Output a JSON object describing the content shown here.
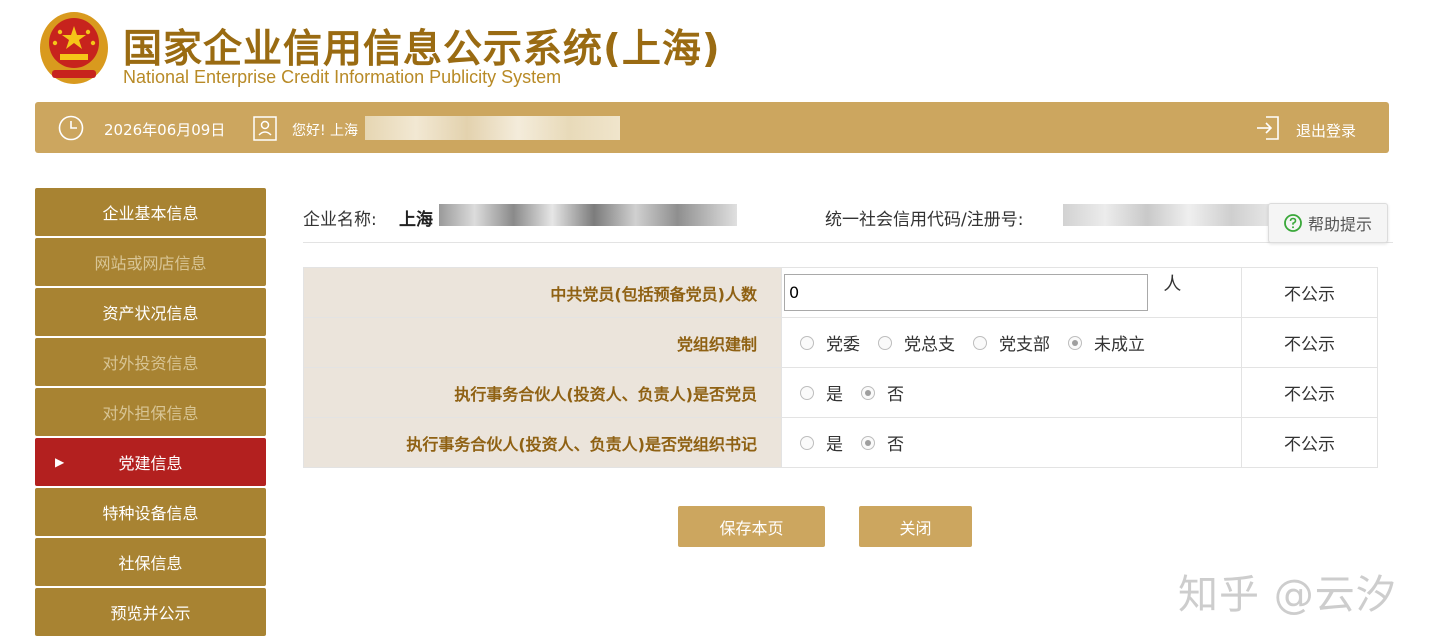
{
  "header": {
    "title_cn": "国家企业信用信息公示系统(上海)",
    "title_en": "National Enterprise Credit Information Publicity System",
    "emblem_icon": "national-emblem-icon"
  },
  "topbar": {
    "date": "2026年06月09日",
    "greeting": "您好! 上海",
    "logout": "退出登录"
  },
  "sidebar": {
    "items": [
      {
        "label": "企业基本信息",
        "state": "normal"
      },
      {
        "label": "网站或网店信息",
        "state": "disabled"
      },
      {
        "label": "资产状况信息",
        "state": "normal"
      },
      {
        "label": "对外投资信息",
        "state": "disabled"
      },
      {
        "label": "对外担保信息",
        "state": "disabled"
      },
      {
        "label": "党建信息",
        "state": "active"
      },
      {
        "label": "特种设备信息",
        "state": "normal"
      },
      {
        "label": "社保信息",
        "state": "normal"
      },
      {
        "label": "预览并公示",
        "state": "normal"
      }
    ]
  },
  "company": {
    "name_label": "企业名称:",
    "name_value": "上海",
    "code_label": "统一社会信用代码/注册号:"
  },
  "help": {
    "label": "帮助提示"
  },
  "form": {
    "rows": [
      {
        "label": "中共党员(包括预备党员)人数",
        "input_value": "0",
        "unit": "人",
        "publicity": "不公示"
      },
      {
        "label": "党组织建制",
        "options": [
          "党委",
          "党总支",
          "党支部",
          "未成立"
        ],
        "selected": "未成立",
        "publicity": "不公示"
      },
      {
        "label": "执行事务合伙人(投资人、负责人)是否党员",
        "options": [
          "是",
          "否"
        ],
        "selected": "否",
        "publicity": "不公示"
      },
      {
        "label": "执行事务合伙人(投资人、负责人)是否党组织书记",
        "options": [
          "是",
          "否"
        ],
        "selected": "否",
        "publicity": "不公示"
      }
    ]
  },
  "buttons": {
    "save": "保存本页",
    "close": "关闭"
  },
  "watermark": "知乎 @云汐",
  "colors": {
    "gold": "#cca65f",
    "sidebar": "#a88332",
    "active": "#b3201f",
    "label_bg": "#ebe4db",
    "label_text": "#8f6113",
    "title": "#9a6b12"
  }
}
